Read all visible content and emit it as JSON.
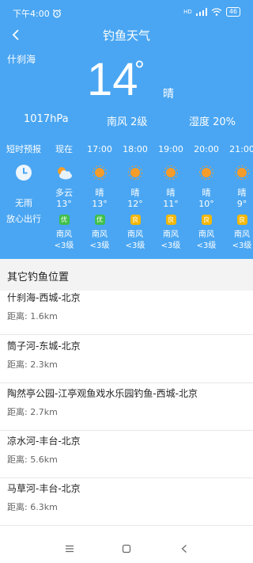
{
  "status_bar": {
    "time": "下午4:00",
    "network": "HD",
    "battery": "46"
  },
  "header": {
    "title": "钓鱼天气"
  },
  "current": {
    "location": "什刹海",
    "temperature": "14",
    "degree_symbol": "°",
    "condition": "晴",
    "pressure": "1017hPa",
    "wind": "南风 2级",
    "humidity": "湿度 20%"
  },
  "forecast_side": {
    "label": "短时预报",
    "line1": "无雨",
    "line2": "放心出行"
  },
  "hourly": [
    {
      "time": "现在",
      "icon": "partly-cloudy",
      "cond": "多云",
      "temp": "13°",
      "aq": "优",
      "aq_color": "#3fc04a",
      "wind": "南风",
      "level": "<3级"
    },
    {
      "time": "17:00",
      "icon": "sun",
      "cond": "晴",
      "temp": "13°",
      "aq": "优",
      "aq_color": "#3fc04a",
      "wind": "南风",
      "level": "<3级"
    },
    {
      "time": "18:00",
      "icon": "sun",
      "cond": "晴",
      "temp": "12°",
      "aq": "良",
      "aq_color": "#f2b705",
      "wind": "南风",
      "level": "<3级"
    },
    {
      "time": "19:00",
      "icon": "sun",
      "cond": "晴",
      "temp": "11°",
      "aq": "良",
      "aq_color": "#f2b705",
      "wind": "南风",
      "level": "<3级"
    },
    {
      "time": "20:00",
      "icon": "sun",
      "cond": "晴",
      "temp": "10°",
      "aq": "良",
      "aq_color": "#f2b705",
      "wind": "南风",
      "level": "<3级"
    },
    {
      "time": "21:00",
      "icon": "sun",
      "cond": "晴",
      "temp": "9°",
      "aq": "良",
      "aq_color": "#f2b705",
      "wind": "南风",
      "level": "<3级"
    }
  ],
  "other_spots": {
    "heading": "其它钓鱼位置",
    "items": [
      {
        "name": "什刹海-西城-北京",
        "distance": "距离: 1.6km"
      },
      {
        "name": "筒子河-东城-北京",
        "distance": "距离: 2.3km"
      },
      {
        "name": "陶然亭公园-江亭观鱼戏水乐园钓鱼-西城-北京",
        "distance": "距离: 2.7km"
      },
      {
        "name": "凉水河-丰台-北京",
        "distance": "距离: 5.6km"
      },
      {
        "name": "马草河-丰台-北京",
        "distance": "距离: 6.3km"
      }
    ]
  },
  "colors": {
    "hero_bg": "#4aa6f2",
    "sun": "#f59c2a",
    "aq_good": "#3fc04a",
    "aq_fair": "#f2b705"
  }
}
